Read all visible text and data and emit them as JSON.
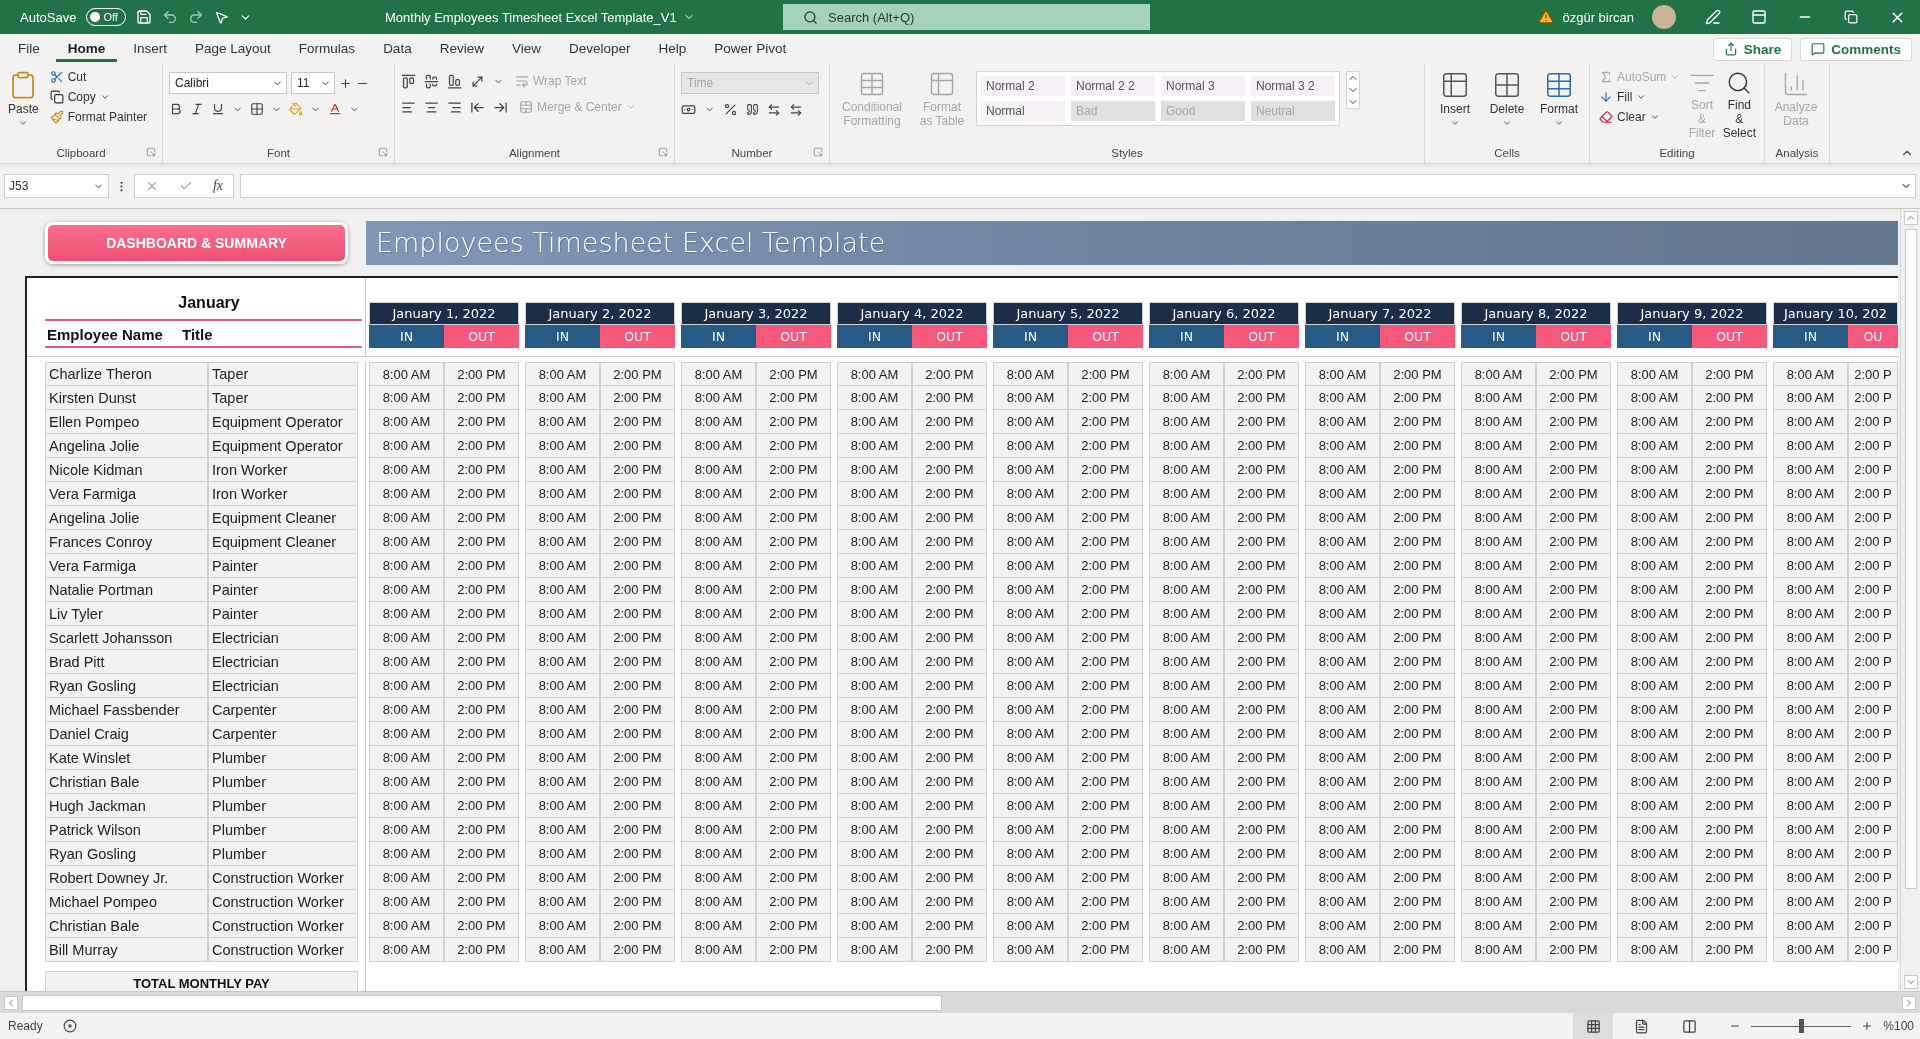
{
  "title_bar": {
    "autosave_label": "AutoSave",
    "autosave_state": "Off",
    "autosave_on": false,
    "document_title": "Monthly Employees Timesheet Excel Template_V1",
    "search_placeholder": "Search (Alt+Q)",
    "user_name": "özgür bircan"
  },
  "menu_tabs": [
    {
      "label": "File",
      "selected": false
    },
    {
      "label": "Home",
      "selected": true
    },
    {
      "label": "Insert",
      "selected": false
    },
    {
      "label": "Page Layout",
      "selected": false
    },
    {
      "label": "Formulas",
      "selected": false
    },
    {
      "label": "Data",
      "selected": false
    },
    {
      "label": "Review",
      "selected": false
    },
    {
      "label": "View",
      "selected": false
    },
    {
      "label": "Developer",
      "selected": false
    },
    {
      "label": "Help",
      "selected": false
    },
    {
      "label": "Power Pivot",
      "selected": false
    }
  ],
  "share_button": "Share",
  "comments_button": "Comments",
  "ribbon": {
    "clipboard": {
      "label": "Clipboard",
      "paste": "Paste",
      "cut": "Cut",
      "copy": "Copy",
      "format_painter": "Format Painter"
    },
    "font": {
      "label": "Font",
      "family": "Calibri",
      "size": "11"
    },
    "alignment": {
      "label": "Alignment",
      "wrap_text": {
        "label": "Wrap Text",
        "disabled": true
      },
      "merge_center": {
        "label": "Merge & Center",
        "disabled": true
      }
    },
    "number": {
      "label": "Number",
      "format": {
        "value": "Time",
        "disabled": true
      }
    },
    "styles": {
      "label": "Styles",
      "conditional_formatting": {
        "label": "Conditional Formatting",
        "disabled": true
      },
      "format_as_table": {
        "label": "Format as Table",
        "disabled": true
      },
      "gallery": [
        {
          "label": "Normal 2",
          "dimmed": false
        },
        {
          "label": "Normal 2 2",
          "dimmed": false
        },
        {
          "label": "Normal 3",
          "dimmed": false
        },
        {
          "label": "Normal 3 2",
          "dimmed": false
        },
        {
          "label": "Normal",
          "dimmed": false
        },
        {
          "label": "Bad",
          "dimmed": true
        },
        {
          "label": "Good",
          "dimmed": true
        },
        {
          "label": "Neutral",
          "dimmed": true
        }
      ]
    },
    "cells": {
      "label": "Cells",
      "buttons": [
        {
          "label": "Insert",
          "kind": "insert"
        },
        {
          "label": "Delete",
          "kind": "delete"
        },
        {
          "label": "Format",
          "kind": "format"
        }
      ]
    },
    "editing": {
      "label": "Editing",
      "autosum": {
        "label": "AutoSum",
        "disabled": true
      },
      "fill": {
        "label": "Fill",
        "disabled": false
      },
      "clear": {
        "label": "Clear",
        "disabled": false
      },
      "sort_filter": {
        "label": "Sort & Filter",
        "disabled": true
      },
      "find_select": {
        "label": "Find & Select",
        "disabled": false
      }
    },
    "analysis": {
      "label": "Analysis",
      "analyze_data": {
        "label": "Analyze Data",
        "disabled": true
      }
    }
  },
  "formula_bar": {
    "name_box": "J53",
    "function_label": "fx"
  },
  "sheet": {
    "dashboard_button": "DASHBOARD & SUMMARY",
    "banner_title": "Employees Timesheet Excel Template",
    "month": "January",
    "name_header": "Employee Name",
    "title_header": "Title",
    "total_label": "TOTAL MONTHLY PAY",
    "dates": [
      {
        "date": "January 1, 2022",
        "in": "IN",
        "out": "OUT"
      },
      {
        "date": "January 2, 2022",
        "in": "IN",
        "out": "OUT"
      },
      {
        "date": "January 3, 2022",
        "in": "IN",
        "out": "OUT"
      },
      {
        "date": "January 4, 2022",
        "in": "IN",
        "out": "OUT"
      },
      {
        "date": "January 5, 2022",
        "in": "IN",
        "out": "OUT"
      },
      {
        "date": "January 6, 2022",
        "in": "IN",
        "out": "OUT"
      },
      {
        "date": "January 7, 2022",
        "in": "IN",
        "out": "OUT"
      },
      {
        "date": "January 8, 2022",
        "in": "IN",
        "out": "OUT"
      },
      {
        "date": "January 9, 2022",
        "in": "IN",
        "out": "OUT"
      },
      {
        "date": "January 10, 202",
        "in": "IN",
        "out": "OU"
      }
    ],
    "rows": [
      {
        "name": "Charlize Theron",
        "title": "Taper",
        "times": [
          [
            "8:00 AM",
            "2:00 PM"
          ],
          [
            "8:00 AM",
            "2:00 PM"
          ],
          [
            "8:00 AM",
            "2:00 PM"
          ],
          [
            "8:00 AM",
            "2:00 PM"
          ],
          [
            "8:00 AM",
            "2:00 PM"
          ],
          [
            "8:00 AM",
            "2:00 PM"
          ],
          [
            "8:00 AM",
            "2:00 PM"
          ],
          [
            "8:00 AM",
            "2:00 PM"
          ],
          [
            "8:00 AM",
            "2:00 PM"
          ],
          [
            "8:00 AM",
            "2:00 P"
          ]
        ]
      },
      {
        "name": "Kirsten Dunst",
        "title": "Taper",
        "times": [
          [
            "8:00 AM",
            "2:00 PM"
          ],
          [
            "8:00 AM",
            "2:00 PM"
          ],
          [
            "8:00 AM",
            "2:00 PM"
          ],
          [
            "8:00 AM",
            "2:00 PM"
          ],
          [
            "8:00 AM",
            "2:00 PM"
          ],
          [
            "8:00 AM",
            "2:00 PM"
          ],
          [
            "8:00 AM",
            "2:00 PM"
          ],
          [
            "8:00 AM",
            "2:00 PM"
          ],
          [
            "8:00 AM",
            "2:00 PM"
          ],
          [
            "8:00 AM",
            "2:00 P"
          ]
        ]
      },
      {
        "name": "Ellen Pompeo",
        "title": "Equipment Operator",
        "times": [
          [
            "8:00 AM",
            "2:00 PM"
          ],
          [
            "8:00 AM",
            "2:00 PM"
          ],
          [
            "8:00 AM",
            "2:00 PM"
          ],
          [
            "8:00 AM",
            "2:00 PM"
          ],
          [
            "8:00 AM",
            "2:00 PM"
          ],
          [
            "8:00 AM",
            "2:00 PM"
          ],
          [
            "8:00 AM",
            "2:00 PM"
          ],
          [
            "8:00 AM",
            "2:00 PM"
          ],
          [
            "8:00 AM",
            "2:00 PM"
          ],
          [
            "8:00 AM",
            "2:00 P"
          ]
        ]
      },
      {
        "name": "Angelina Jolie",
        "title": "Equipment Operator",
        "times": [
          [
            "8:00 AM",
            "2:00 PM"
          ],
          [
            "8:00 AM",
            "2:00 PM"
          ],
          [
            "8:00 AM",
            "2:00 PM"
          ],
          [
            "8:00 AM",
            "2:00 PM"
          ],
          [
            "8:00 AM",
            "2:00 PM"
          ],
          [
            "8:00 AM",
            "2:00 PM"
          ],
          [
            "8:00 AM",
            "2:00 PM"
          ],
          [
            "8:00 AM",
            "2:00 PM"
          ],
          [
            "8:00 AM",
            "2:00 PM"
          ],
          [
            "8:00 AM",
            "2:00 P"
          ]
        ]
      },
      {
        "name": "Nicole Kidman",
        "title": "Iron Worker",
        "times": [
          [
            "8:00 AM",
            "2:00 PM"
          ],
          [
            "8:00 AM",
            "2:00 PM"
          ],
          [
            "8:00 AM",
            "2:00 PM"
          ],
          [
            "8:00 AM",
            "2:00 PM"
          ],
          [
            "8:00 AM",
            "2:00 PM"
          ],
          [
            "8:00 AM",
            "2:00 PM"
          ],
          [
            "8:00 AM",
            "2:00 PM"
          ],
          [
            "8:00 AM",
            "2:00 PM"
          ],
          [
            "8:00 AM",
            "2:00 PM"
          ],
          [
            "8:00 AM",
            "2:00 P"
          ]
        ]
      },
      {
        "name": "Vera Farmiga",
        "title": "Iron Worker",
        "times": [
          [
            "8:00 AM",
            "2:00 PM"
          ],
          [
            "8:00 AM",
            "2:00 PM"
          ],
          [
            "8:00 AM",
            "2:00 PM"
          ],
          [
            "8:00 AM",
            "2:00 PM"
          ],
          [
            "8:00 AM",
            "2:00 PM"
          ],
          [
            "8:00 AM",
            "2:00 PM"
          ],
          [
            "8:00 AM",
            "2:00 PM"
          ],
          [
            "8:00 AM",
            "2:00 PM"
          ],
          [
            "8:00 AM",
            "2:00 PM"
          ],
          [
            "8:00 AM",
            "2:00 P"
          ]
        ]
      },
      {
        "name": "Angelina Jolie",
        "title": "Equipment Cleaner",
        "times": [
          [
            "8:00 AM",
            "2:00 PM"
          ],
          [
            "8:00 AM",
            "2:00 PM"
          ],
          [
            "8:00 AM",
            "2:00 PM"
          ],
          [
            "8:00 AM",
            "2:00 PM"
          ],
          [
            "8:00 AM",
            "2:00 PM"
          ],
          [
            "8:00 AM",
            "2:00 PM"
          ],
          [
            "8:00 AM",
            "2:00 PM"
          ],
          [
            "8:00 AM",
            "2:00 PM"
          ],
          [
            "8:00 AM",
            "2:00 PM"
          ],
          [
            "8:00 AM",
            "2:00 P"
          ]
        ]
      },
      {
        "name": "Frances Conroy",
        "title": "Equipment Cleaner",
        "times": [
          [
            "8:00 AM",
            "2:00 PM"
          ],
          [
            "8:00 AM",
            "2:00 PM"
          ],
          [
            "8:00 AM",
            "2:00 PM"
          ],
          [
            "8:00 AM",
            "2:00 PM"
          ],
          [
            "8:00 AM",
            "2:00 PM"
          ],
          [
            "8:00 AM",
            "2:00 PM"
          ],
          [
            "8:00 AM",
            "2:00 PM"
          ],
          [
            "8:00 AM",
            "2:00 PM"
          ],
          [
            "8:00 AM",
            "2:00 PM"
          ],
          [
            "8:00 AM",
            "2:00 P"
          ]
        ]
      },
      {
        "name": "Vera Farmiga",
        "title": "Painter",
        "times": [
          [
            "8:00 AM",
            "2:00 PM"
          ],
          [
            "8:00 AM",
            "2:00 PM"
          ],
          [
            "8:00 AM",
            "2:00 PM"
          ],
          [
            "8:00 AM",
            "2:00 PM"
          ],
          [
            "8:00 AM",
            "2:00 PM"
          ],
          [
            "8:00 AM",
            "2:00 PM"
          ],
          [
            "8:00 AM",
            "2:00 PM"
          ],
          [
            "8:00 AM",
            "2:00 PM"
          ],
          [
            "8:00 AM",
            "2:00 PM"
          ],
          [
            "8:00 AM",
            "2:00 P"
          ]
        ]
      },
      {
        "name": "Natalie Portman",
        "title": "Painter",
        "times": [
          [
            "8:00 AM",
            "2:00 PM"
          ],
          [
            "8:00 AM",
            "2:00 PM"
          ],
          [
            "8:00 AM",
            "2:00 PM"
          ],
          [
            "8:00 AM",
            "2:00 PM"
          ],
          [
            "8:00 AM",
            "2:00 PM"
          ],
          [
            "8:00 AM",
            "2:00 PM"
          ],
          [
            "8:00 AM",
            "2:00 PM"
          ],
          [
            "8:00 AM",
            "2:00 PM"
          ],
          [
            "8:00 AM",
            "2:00 PM"
          ],
          [
            "8:00 AM",
            "2:00 P"
          ]
        ]
      },
      {
        "name": "Liv Tyler",
        "title": "Painter",
        "times": [
          [
            "8:00 AM",
            "2:00 PM"
          ],
          [
            "8:00 AM",
            "2:00 PM"
          ],
          [
            "8:00 AM",
            "2:00 PM"
          ],
          [
            "8:00 AM",
            "2:00 PM"
          ],
          [
            "8:00 AM",
            "2:00 PM"
          ],
          [
            "8:00 AM",
            "2:00 PM"
          ],
          [
            "8:00 AM",
            "2:00 PM"
          ],
          [
            "8:00 AM",
            "2:00 PM"
          ],
          [
            "8:00 AM",
            "2:00 PM"
          ],
          [
            "8:00 AM",
            "2:00 P"
          ]
        ]
      },
      {
        "name": "Scarlett Johansson",
        "title": "Electrician",
        "times": [
          [
            "8:00 AM",
            "2:00 PM"
          ],
          [
            "8:00 AM",
            "2:00 PM"
          ],
          [
            "8:00 AM",
            "2:00 PM"
          ],
          [
            "8:00 AM",
            "2:00 PM"
          ],
          [
            "8:00 AM",
            "2:00 PM"
          ],
          [
            "8:00 AM",
            "2:00 PM"
          ],
          [
            "8:00 AM",
            "2:00 PM"
          ],
          [
            "8:00 AM",
            "2:00 PM"
          ],
          [
            "8:00 AM",
            "2:00 PM"
          ],
          [
            "8:00 AM",
            "2:00 P"
          ]
        ]
      },
      {
        "name": "Brad Pitt",
        "title": "Electrician",
        "times": [
          [
            "8:00 AM",
            "2:00 PM"
          ],
          [
            "8:00 AM",
            "2:00 PM"
          ],
          [
            "8:00 AM",
            "2:00 PM"
          ],
          [
            "8:00 AM",
            "2:00 PM"
          ],
          [
            "8:00 AM",
            "2:00 PM"
          ],
          [
            "8:00 AM",
            "2:00 PM"
          ],
          [
            "8:00 AM",
            "2:00 PM"
          ],
          [
            "8:00 AM",
            "2:00 PM"
          ],
          [
            "8:00 AM",
            "2:00 PM"
          ],
          [
            "8:00 AM",
            "2:00 P"
          ]
        ]
      },
      {
        "name": "Ryan Gosling",
        "title": "Electrician",
        "times": [
          [
            "8:00 AM",
            "2:00 PM"
          ],
          [
            "8:00 AM",
            "2:00 PM"
          ],
          [
            "8:00 AM",
            "2:00 PM"
          ],
          [
            "8:00 AM",
            "2:00 PM"
          ],
          [
            "8:00 AM",
            "2:00 PM"
          ],
          [
            "8:00 AM",
            "2:00 PM"
          ],
          [
            "8:00 AM",
            "2:00 PM"
          ],
          [
            "8:00 AM",
            "2:00 PM"
          ],
          [
            "8:00 AM",
            "2:00 PM"
          ],
          [
            "8:00 AM",
            "2:00 P"
          ]
        ]
      },
      {
        "name": "Michael Fassbender",
        "title": "Carpenter",
        "times": [
          [
            "8:00 AM",
            "2:00 PM"
          ],
          [
            "8:00 AM",
            "2:00 PM"
          ],
          [
            "8:00 AM",
            "2:00 PM"
          ],
          [
            "8:00 AM",
            "2:00 PM"
          ],
          [
            "8:00 AM",
            "2:00 PM"
          ],
          [
            "8:00 AM",
            "2:00 PM"
          ],
          [
            "8:00 AM",
            "2:00 PM"
          ],
          [
            "8:00 AM",
            "2:00 PM"
          ],
          [
            "8:00 AM",
            "2:00 PM"
          ],
          [
            "8:00 AM",
            "2:00 P"
          ]
        ]
      },
      {
        "name": "Daniel Craig",
        "title": "Carpenter",
        "times": [
          [
            "8:00 AM",
            "2:00 PM"
          ],
          [
            "8:00 AM",
            "2:00 PM"
          ],
          [
            "8:00 AM",
            "2:00 PM"
          ],
          [
            "8:00 AM",
            "2:00 PM"
          ],
          [
            "8:00 AM",
            "2:00 PM"
          ],
          [
            "8:00 AM",
            "2:00 PM"
          ],
          [
            "8:00 AM",
            "2:00 PM"
          ],
          [
            "8:00 AM",
            "2:00 PM"
          ],
          [
            "8:00 AM",
            "2:00 PM"
          ],
          [
            "8:00 AM",
            "2:00 P"
          ]
        ]
      },
      {
        "name": "Kate Winslet",
        "title": "Plumber",
        "times": [
          [
            "8:00 AM",
            "2:00 PM"
          ],
          [
            "8:00 AM",
            "2:00 PM"
          ],
          [
            "8:00 AM",
            "2:00 PM"
          ],
          [
            "8:00 AM",
            "2:00 PM"
          ],
          [
            "8:00 AM",
            "2:00 PM"
          ],
          [
            "8:00 AM",
            "2:00 PM"
          ],
          [
            "8:00 AM",
            "2:00 PM"
          ],
          [
            "8:00 AM",
            "2:00 PM"
          ],
          [
            "8:00 AM",
            "2:00 PM"
          ],
          [
            "8:00 AM",
            "2:00 P"
          ]
        ]
      },
      {
        "name": "Christian Bale",
        "title": "Plumber",
        "times": [
          [
            "8:00 AM",
            "2:00 PM"
          ],
          [
            "8:00 AM",
            "2:00 PM"
          ],
          [
            "8:00 AM",
            "2:00 PM"
          ],
          [
            "8:00 AM",
            "2:00 PM"
          ],
          [
            "8:00 AM",
            "2:00 PM"
          ],
          [
            "8:00 AM",
            "2:00 PM"
          ],
          [
            "8:00 AM",
            "2:00 PM"
          ],
          [
            "8:00 AM",
            "2:00 PM"
          ],
          [
            "8:00 AM",
            "2:00 PM"
          ],
          [
            "8:00 AM",
            "2:00 P"
          ]
        ]
      },
      {
        "name": "Hugh Jackman",
        "title": "Plumber",
        "times": [
          [
            "8:00 AM",
            "2:00 PM"
          ],
          [
            "8:00 AM",
            "2:00 PM"
          ],
          [
            "8:00 AM",
            "2:00 PM"
          ],
          [
            "8:00 AM",
            "2:00 PM"
          ],
          [
            "8:00 AM",
            "2:00 PM"
          ],
          [
            "8:00 AM",
            "2:00 PM"
          ],
          [
            "8:00 AM",
            "2:00 PM"
          ],
          [
            "8:00 AM",
            "2:00 PM"
          ],
          [
            "8:00 AM",
            "2:00 PM"
          ],
          [
            "8:00 AM",
            "2:00 P"
          ]
        ]
      },
      {
        "name": "Patrick Wilson",
        "title": "Plumber",
        "times": [
          [
            "8:00 AM",
            "2:00 PM"
          ],
          [
            "8:00 AM",
            "2:00 PM"
          ],
          [
            "8:00 AM",
            "2:00 PM"
          ],
          [
            "8:00 AM",
            "2:00 PM"
          ],
          [
            "8:00 AM",
            "2:00 PM"
          ],
          [
            "8:00 AM",
            "2:00 PM"
          ],
          [
            "8:00 AM",
            "2:00 PM"
          ],
          [
            "8:00 AM",
            "2:00 PM"
          ],
          [
            "8:00 AM",
            "2:00 PM"
          ],
          [
            "8:00 AM",
            "2:00 P"
          ]
        ]
      },
      {
        "name": "Ryan Gosling",
        "title": "Plumber",
        "times": [
          [
            "8:00 AM",
            "2:00 PM"
          ],
          [
            "8:00 AM",
            "2:00 PM"
          ],
          [
            "8:00 AM",
            "2:00 PM"
          ],
          [
            "8:00 AM",
            "2:00 PM"
          ],
          [
            "8:00 AM",
            "2:00 PM"
          ],
          [
            "8:00 AM",
            "2:00 PM"
          ],
          [
            "8:00 AM",
            "2:00 PM"
          ],
          [
            "8:00 AM",
            "2:00 PM"
          ],
          [
            "8:00 AM",
            "2:00 PM"
          ],
          [
            "8:00 AM",
            "2:00 P"
          ]
        ]
      },
      {
        "name": "Robert Downey Jr.",
        "title": "Construction Worker",
        "times": [
          [
            "8:00 AM",
            "2:00 PM"
          ],
          [
            "8:00 AM",
            "2:00 PM"
          ],
          [
            "8:00 AM",
            "2:00 PM"
          ],
          [
            "8:00 AM",
            "2:00 PM"
          ],
          [
            "8:00 AM",
            "2:00 PM"
          ],
          [
            "8:00 AM",
            "2:00 PM"
          ],
          [
            "8:00 AM",
            "2:00 PM"
          ],
          [
            "8:00 AM",
            "2:00 PM"
          ],
          [
            "8:00 AM",
            "2:00 PM"
          ],
          [
            "8:00 AM",
            "2:00 P"
          ]
        ]
      },
      {
        "name": "Michael Pompeo",
        "title": "Construction Worker",
        "times": [
          [
            "8:00 AM",
            "2:00 PM"
          ],
          [
            "8:00 AM",
            "2:00 PM"
          ],
          [
            "8:00 AM",
            "2:00 PM"
          ],
          [
            "8:00 AM",
            "2:00 PM"
          ],
          [
            "8:00 AM",
            "2:00 PM"
          ],
          [
            "8:00 AM",
            "2:00 PM"
          ],
          [
            "8:00 AM",
            "2:00 PM"
          ],
          [
            "8:00 AM",
            "2:00 PM"
          ],
          [
            "8:00 AM",
            "2:00 PM"
          ],
          [
            "8:00 AM",
            "2:00 P"
          ]
        ]
      },
      {
        "name": "Christian Bale",
        "title": "Construction Worker",
        "times": [
          [
            "8:00 AM",
            "2:00 PM"
          ],
          [
            "8:00 AM",
            "2:00 PM"
          ],
          [
            "8:00 AM",
            "2:00 PM"
          ],
          [
            "8:00 AM",
            "2:00 PM"
          ],
          [
            "8:00 AM",
            "2:00 PM"
          ],
          [
            "8:00 AM",
            "2:00 PM"
          ],
          [
            "8:00 AM",
            "2:00 PM"
          ],
          [
            "8:00 AM",
            "2:00 PM"
          ],
          [
            "8:00 AM",
            "2:00 PM"
          ],
          [
            "8:00 AM",
            "2:00 P"
          ]
        ]
      },
      {
        "name": "Bill Murray",
        "title": "Construction Worker",
        "times": [
          [
            "8:00 AM",
            "2:00 PM"
          ],
          [
            "8:00 AM",
            "2:00 PM"
          ],
          [
            "8:00 AM",
            "2:00 PM"
          ],
          [
            "8:00 AM",
            "2:00 PM"
          ],
          [
            "8:00 AM",
            "2:00 PM"
          ],
          [
            "8:00 AM",
            "2:00 PM"
          ],
          [
            "8:00 AM",
            "2:00 PM"
          ],
          [
            "8:00 AM",
            "2:00 PM"
          ],
          [
            "8:00 AM",
            "2:00 PM"
          ],
          [
            "8:00 AM",
            "2:00 P"
          ]
        ]
      }
    ]
  },
  "status_bar": {
    "status": "Ready",
    "views": [
      {
        "kind": "normal",
        "selected": true
      },
      {
        "kind": "page_layout",
        "selected": false
      },
      {
        "kind": "page_break",
        "selected": false
      }
    ],
    "zoom": {
      "level": 0.5,
      "reading": "%100"
    }
  }
}
